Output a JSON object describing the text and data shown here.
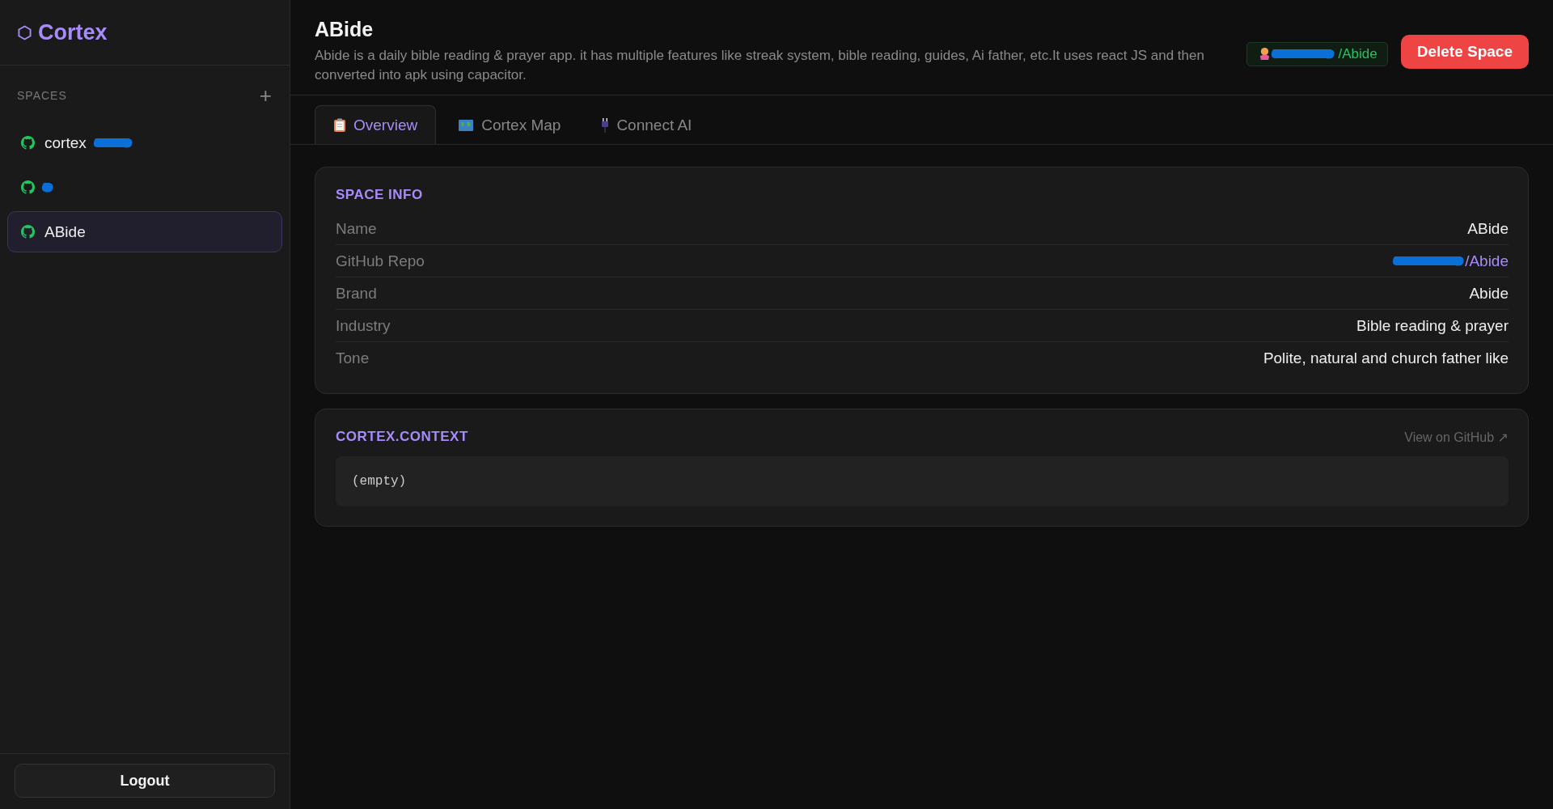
{
  "sidebar": {
    "logo": "Cortex",
    "section_label": "SPACES",
    "add_button": "+",
    "items": [
      {
        "label": "cortex",
        "redacted": true,
        "selected": false
      },
      {
        "redacted": true,
        "selected": false
      },
      {
        "label": "ABide",
        "redacted": false,
        "selected": true
      }
    ],
    "logout": "Logout"
  },
  "header": {
    "title": "ABide",
    "description": "Abide is a daily bible reading & prayer app. it has multiple features like streak system, bible reading, guides, Ai father, etc.It uses react JS and then converted into apk using capacitor.",
    "repo_badge": {
      "text": "/Abide",
      "redacted": true
    },
    "delete_button": "Delete Space"
  },
  "tabs": [
    {
      "label": "Overview",
      "kind": "clipboard",
      "selected": true
    },
    {
      "label": "Cortex Map",
      "kind": "map",
      "selected": false
    },
    {
      "label": "Connect AI",
      "kind": "plug",
      "selected": false
    }
  ],
  "space_info": {
    "title": "SPACE INFO",
    "rows": [
      {
        "label": "Name",
        "value": "ABide"
      },
      {
        "label": "GitHub Repo",
        "value": "/Abide",
        "kind": "link",
        "redacted": true
      },
      {
        "label": "Brand",
        "value": "Abide"
      },
      {
        "label": "Industry",
        "value": "Bible reading & prayer"
      },
      {
        "label": "Tone",
        "value": "Polite, natural and church father like"
      }
    ]
  },
  "context": {
    "title": "CORTEX.CONTEXT",
    "link": "View on GitHub ↗",
    "content": "(empty)"
  }
}
